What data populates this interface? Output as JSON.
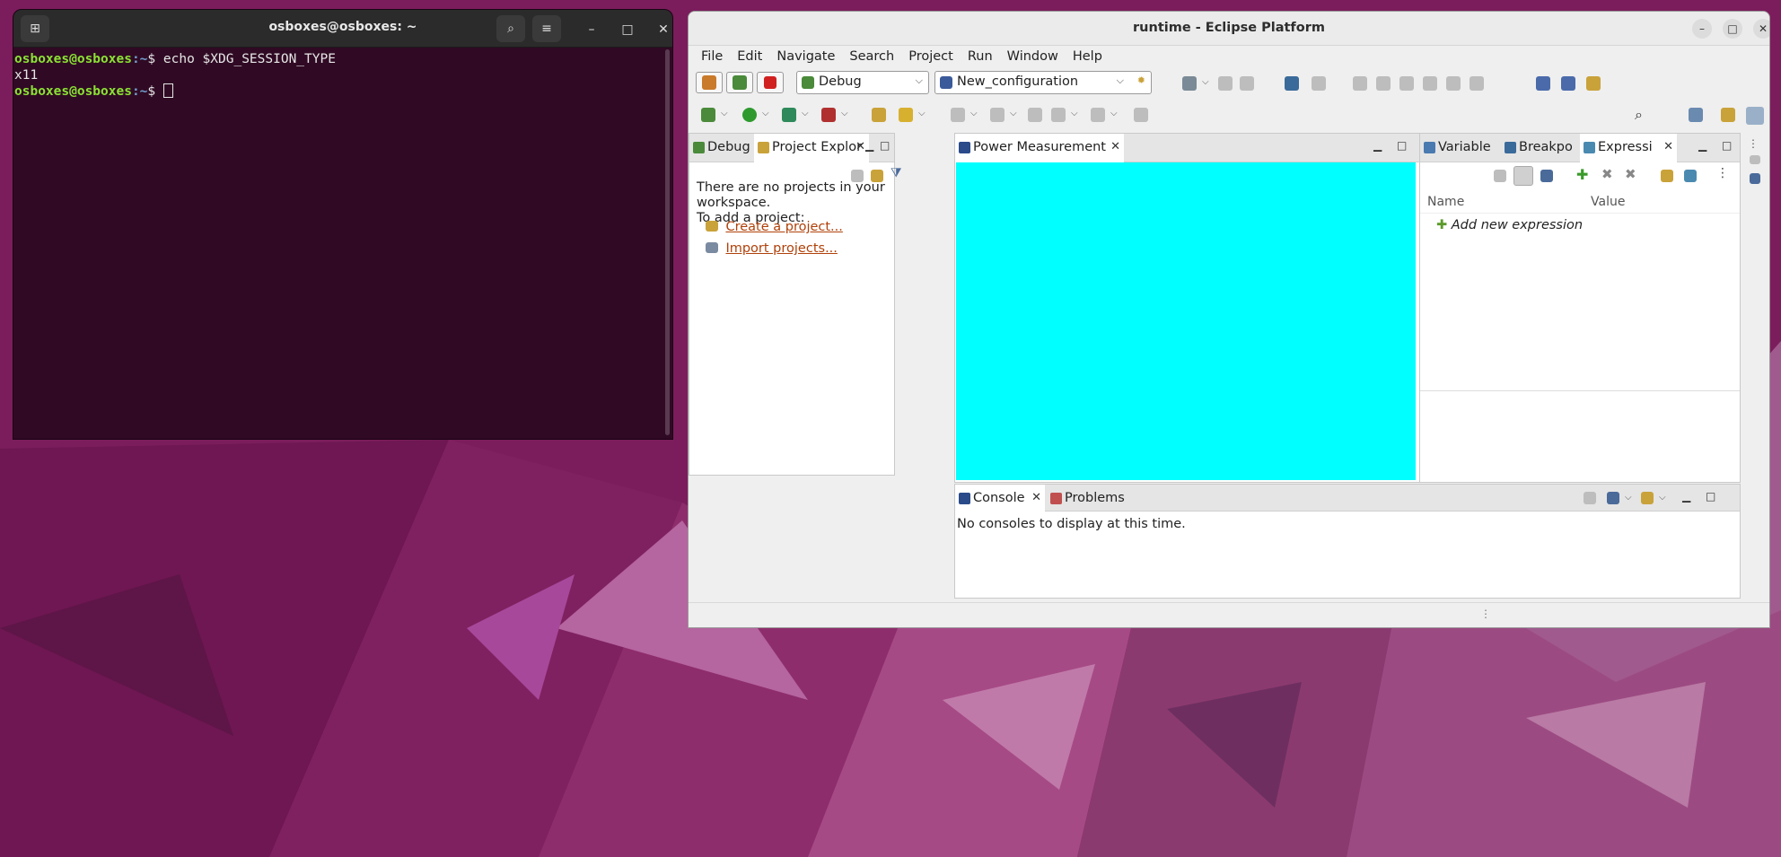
{
  "terminal": {
    "title": "osboxes@osboxes: ~",
    "lines": [
      {
        "user": "osboxes@osboxes",
        "path": ":~",
        "prompt": "$ ",
        "cmd": "echo $XDG_SESSION_TYPE"
      },
      {
        "output": "x11"
      },
      {
        "user": "osboxes@osboxes",
        "path": ":~",
        "prompt": "$ ",
        "cmd": ""
      }
    ]
  },
  "eclipse": {
    "title": "runtime - Eclipse Platform",
    "menu": [
      "File",
      "Edit",
      "Navigate",
      "Search",
      "Project",
      "Run",
      "Window",
      "Help"
    ],
    "launch_mode": "Debug",
    "launch_config": "New_configuration",
    "left_panel": {
      "tabs": [
        "Debug",
        "Project Explor"
      ],
      "message_line1": "There are no projects in your workspace.",
      "message_line2": "To add a project:",
      "link_create": "Create a project...",
      "link_import": "Import projects..."
    },
    "editor": {
      "tab": "Power Measurement",
      "canvas_color": "#00ffff"
    },
    "right_panel": {
      "tabs": [
        "Variable",
        "Breakpo",
        "Expressi"
      ],
      "col_name": "Name",
      "col_value": "Value",
      "add_expression": "Add new expression"
    },
    "bottom_panel": {
      "tabs": [
        "Console",
        "Problems"
      ],
      "message": "No consoles to display at this time."
    }
  }
}
